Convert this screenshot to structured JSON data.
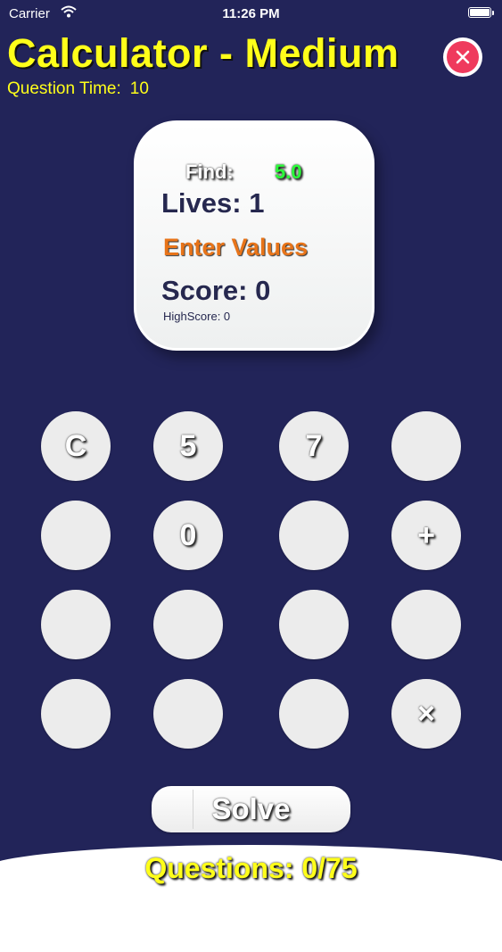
{
  "status_bar": {
    "carrier": "Carrier",
    "time": "11:26 PM",
    "icons": [
      "wifi-icon",
      "battery-icon"
    ]
  },
  "header": {
    "title": "Calculator - Medium",
    "question_time_label": "Question Time:",
    "question_time_value": "10",
    "close_icon": "close-icon"
  },
  "card": {
    "find_label": "Find:",
    "find_value": "5.0",
    "lives": "Lives: 1",
    "prompt": "Enter Values",
    "score": "Score: 0",
    "highscore": "HighScore: 0"
  },
  "keypad": [
    [
      "C",
      "5",
      "7",
      ""
    ],
    [
      "",
      "0",
      "",
      "+"
    ],
    [
      "",
      "",
      "",
      ""
    ],
    [
      "",
      "",
      "",
      "×"
    ]
  ],
  "solve_label": "Solve",
  "footer": {
    "questions": "Questions: 0/75"
  },
  "colors": {
    "background": "#222459",
    "title": "#ffff1a",
    "accent": "#e87419",
    "find_value": "#2bff3a",
    "close": "#ef3a5d"
  }
}
